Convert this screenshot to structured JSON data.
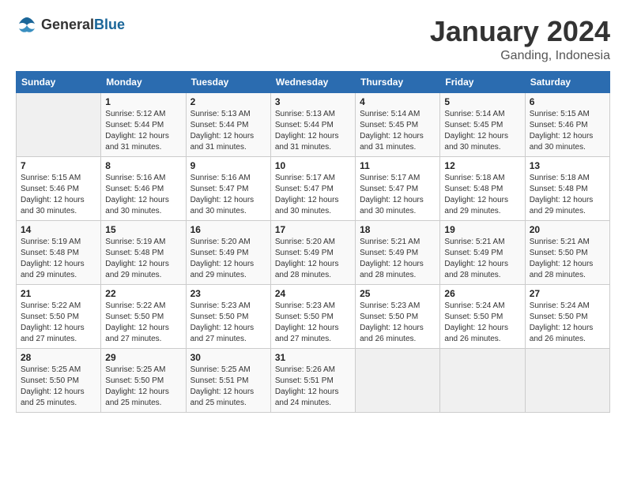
{
  "header": {
    "logo_general": "General",
    "logo_blue": "Blue",
    "month_year": "January 2024",
    "location": "Ganding, Indonesia"
  },
  "days_of_week": [
    "Sunday",
    "Monday",
    "Tuesday",
    "Wednesday",
    "Thursday",
    "Friday",
    "Saturday"
  ],
  "weeks": [
    [
      {
        "day": "",
        "sunrise": "",
        "sunset": "",
        "daylight": ""
      },
      {
        "day": "1",
        "sunrise": "Sunrise: 5:12 AM",
        "sunset": "Sunset: 5:44 PM",
        "daylight": "Daylight: 12 hours and 31 minutes."
      },
      {
        "day": "2",
        "sunrise": "Sunrise: 5:13 AM",
        "sunset": "Sunset: 5:44 PM",
        "daylight": "Daylight: 12 hours and 31 minutes."
      },
      {
        "day": "3",
        "sunrise": "Sunrise: 5:13 AM",
        "sunset": "Sunset: 5:44 PM",
        "daylight": "Daylight: 12 hours and 31 minutes."
      },
      {
        "day": "4",
        "sunrise": "Sunrise: 5:14 AM",
        "sunset": "Sunset: 5:45 PM",
        "daylight": "Daylight: 12 hours and 31 minutes."
      },
      {
        "day": "5",
        "sunrise": "Sunrise: 5:14 AM",
        "sunset": "Sunset: 5:45 PM",
        "daylight": "Daylight: 12 hours and 30 minutes."
      },
      {
        "day": "6",
        "sunrise": "Sunrise: 5:15 AM",
        "sunset": "Sunset: 5:46 PM",
        "daylight": "Daylight: 12 hours and 30 minutes."
      }
    ],
    [
      {
        "day": "7",
        "sunrise": "Sunrise: 5:15 AM",
        "sunset": "Sunset: 5:46 PM",
        "daylight": "Daylight: 12 hours and 30 minutes."
      },
      {
        "day": "8",
        "sunrise": "Sunrise: 5:16 AM",
        "sunset": "Sunset: 5:46 PM",
        "daylight": "Daylight: 12 hours and 30 minutes."
      },
      {
        "day": "9",
        "sunrise": "Sunrise: 5:16 AM",
        "sunset": "Sunset: 5:47 PM",
        "daylight": "Daylight: 12 hours and 30 minutes."
      },
      {
        "day": "10",
        "sunrise": "Sunrise: 5:17 AM",
        "sunset": "Sunset: 5:47 PM",
        "daylight": "Daylight: 12 hours and 30 minutes."
      },
      {
        "day": "11",
        "sunrise": "Sunrise: 5:17 AM",
        "sunset": "Sunset: 5:47 PM",
        "daylight": "Daylight: 12 hours and 30 minutes."
      },
      {
        "day": "12",
        "sunrise": "Sunrise: 5:18 AM",
        "sunset": "Sunset: 5:48 PM",
        "daylight": "Daylight: 12 hours and 29 minutes."
      },
      {
        "day": "13",
        "sunrise": "Sunrise: 5:18 AM",
        "sunset": "Sunset: 5:48 PM",
        "daylight": "Daylight: 12 hours and 29 minutes."
      }
    ],
    [
      {
        "day": "14",
        "sunrise": "Sunrise: 5:19 AM",
        "sunset": "Sunset: 5:48 PM",
        "daylight": "Daylight: 12 hours and 29 minutes."
      },
      {
        "day": "15",
        "sunrise": "Sunrise: 5:19 AM",
        "sunset": "Sunset: 5:48 PM",
        "daylight": "Daylight: 12 hours and 29 minutes."
      },
      {
        "day": "16",
        "sunrise": "Sunrise: 5:20 AM",
        "sunset": "Sunset: 5:49 PM",
        "daylight": "Daylight: 12 hours and 29 minutes."
      },
      {
        "day": "17",
        "sunrise": "Sunrise: 5:20 AM",
        "sunset": "Sunset: 5:49 PM",
        "daylight": "Daylight: 12 hours and 28 minutes."
      },
      {
        "day": "18",
        "sunrise": "Sunrise: 5:21 AM",
        "sunset": "Sunset: 5:49 PM",
        "daylight": "Daylight: 12 hours and 28 minutes."
      },
      {
        "day": "19",
        "sunrise": "Sunrise: 5:21 AM",
        "sunset": "Sunset: 5:49 PM",
        "daylight": "Daylight: 12 hours and 28 minutes."
      },
      {
        "day": "20",
        "sunrise": "Sunrise: 5:21 AM",
        "sunset": "Sunset: 5:50 PM",
        "daylight": "Daylight: 12 hours and 28 minutes."
      }
    ],
    [
      {
        "day": "21",
        "sunrise": "Sunrise: 5:22 AM",
        "sunset": "Sunset: 5:50 PM",
        "daylight": "Daylight: 12 hours and 27 minutes."
      },
      {
        "day": "22",
        "sunrise": "Sunrise: 5:22 AM",
        "sunset": "Sunset: 5:50 PM",
        "daylight": "Daylight: 12 hours and 27 minutes."
      },
      {
        "day": "23",
        "sunrise": "Sunrise: 5:23 AM",
        "sunset": "Sunset: 5:50 PM",
        "daylight": "Daylight: 12 hours and 27 minutes."
      },
      {
        "day": "24",
        "sunrise": "Sunrise: 5:23 AM",
        "sunset": "Sunset: 5:50 PM",
        "daylight": "Daylight: 12 hours and 27 minutes."
      },
      {
        "day": "25",
        "sunrise": "Sunrise: 5:23 AM",
        "sunset": "Sunset: 5:50 PM",
        "daylight": "Daylight: 12 hours and 26 minutes."
      },
      {
        "day": "26",
        "sunrise": "Sunrise: 5:24 AM",
        "sunset": "Sunset: 5:50 PM",
        "daylight": "Daylight: 12 hours and 26 minutes."
      },
      {
        "day": "27",
        "sunrise": "Sunrise: 5:24 AM",
        "sunset": "Sunset: 5:50 PM",
        "daylight": "Daylight: 12 hours and 26 minutes."
      }
    ],
    [
      {
        "day": "28",
        "sunrise": "Sunrise: 5:25 AM",
        "sunset": "Sunset: 5:50 PM",
        "daylight": "Daylight: 12 hours and 25 minutes."
      },
      {
        "day": "29",
        "sunrise": "Sunrise: 5:25 AM",
        "sunset": "Sunset: 5:50 PM",
        "daylight": "Daylight: 12 hours and 25 minutes."
      },
      {
        "day": "30",
        "sunrise": "Sunrise: 5:25 AM",
        "sunset": "Sunset: 5:51 PM",
        "daylight": "Daylight: 12 hours and 25 minutes."
      },
      {
        "day": "31",
        "sunrise": "Sunrise: 5:26 AM",
        "sunset": "Sunset: 5:51 PM",
        "daylight": "Daylight: 12 hours and 24 minutes."
      },
      {
        "day": "",
        "sunrise": "",
        "sunset": "",
        "daylight": ""
      },
      {
        "day": "",
        "sunrise": "",
        "sunset": "",
        "daylight": ""
      },
      {
        "day": "",
        "sunrise": "",
        "sunset": "",
        "daylight": ""
      }
    ]
  ]
}
